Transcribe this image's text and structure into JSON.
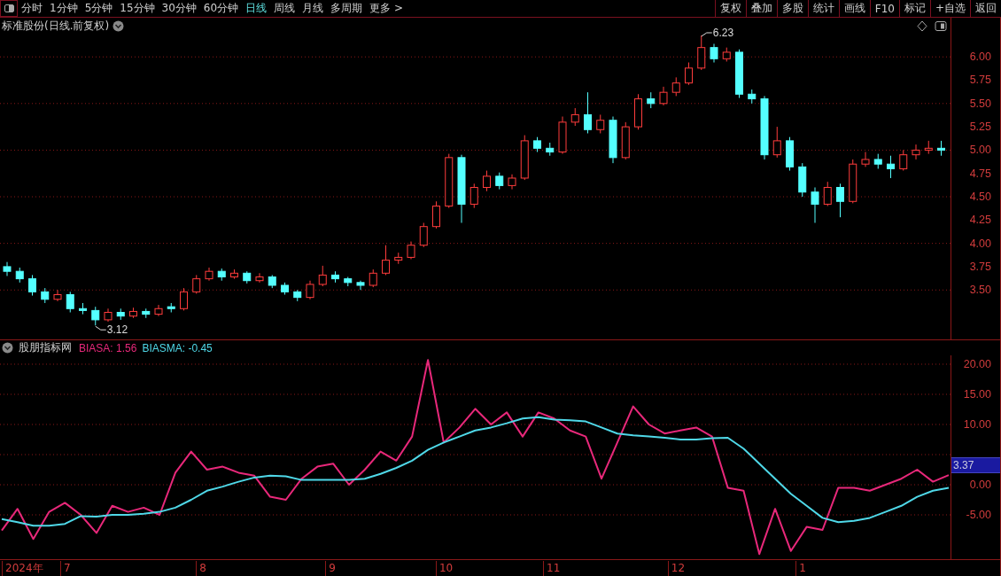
{
  "toolbar": {
    "periods": [
      {
        "label": "分时",
        "selected": false
      },
      {
        "label": "1分钟",
        "selected": false
      },
      {
        "label": "5分钟",
        "selected": false
      },
      {
        "label": "15分钟",
        "selected": false
      },
      {
        "label": "30分钟",
        "selected": false
      },
      {
        "label": "60分钟",
        "selected": false
      },
      {
        "label": "日线",
        "selected": true
      },
      {
        "label": "周线",
        "selected": false
      },
      {
        "label": "月线",
        "selected": false
      },
      {
        "label": "多周期",
        "selected": false
      },
      {
        "label": "更多 >",
        "selected": false
      }
    ],
    "buttons": [
      "复权",
      "叠加",
      "多股",
      "统计",
      "画线",
      "F10",
      "标记",
      "+自选",
      "返回"
    ]
  },
  "price_panel": {
    "title": "标准股份(日线.前复权)",
    "high_label": "6.23",
    "low_label": "3.12",
    "chart_data": {
      "type": "candlestick",
      "grid": true,
      "ylim": [
        2.97,
        6.42
      ],
      "yticks": [
        {
          "value": 6,
          "label": "6.00"
        },
        {
          "value": 5.75,
          "label": "5.75"
        },
        {
          "value": 5.5,
          "label": "5.50"
        },
        {
          "value": 5.25,
          "label": "5.25"
        },
        {
          "value": 5,
          "label": "5.00"
        },
        {
          "value": 4.75,
          "label": "4.75"
        },
        {
          "value": 4.5,
          "label": "4.50"
        },
        {
          "value": 4.25,
          "label": "4.25"
        },
        {
          "value": 4,
          "label": "4.00"
        },
        {
          "value": 3.75,
          "label": "3.75"
        },
        {
          "value": 3.5,
          "label": "3.50"
        }
      ],
      "ohlc": [
        [
          3.75,
          3.8,
          3.65,
          3.7
        ],
        [
          3.7,
          3.74,
          3.58,
          3.62
        ],
        [
          3.62,
          3.66,
          3.44,
          3.48
        ],
        [
          3.48,
          3.52,
          3.36,
          3.4
        ],
        [
          3.4,
          3.5,
          3.38,
          3.45
        ],
        [
          3.45,
          3.48,
          3.26,
          3.3
        ],
        [
          3.3,
          3.36,
          3.24,
          3.28
        ],
        [
          3.28,
          3.32,
          3.12,
          3.18
        ],
        [
          3.18,
          3.3,
          3.16,
          3.26
        ],
        [
          3.26,
          3.3,
          3.18,
          3.22
        ],
        [
          3.22,
          3.31,
          3.2,
          3.27
        ],
        [
          3.27,
          3.3,
          3.2,
          3.24
        ],
        [
          3.24,
          3.34,
          3.22,
          3.3
        ],
        [
          3.32,
          3.36,
          3.26,
          3.3
        ],
        [
          3.3,
          3.52,
          3.28,
          3.48
        ],
        [
          3.48,
          3.66,
          3.46,
          3.62
        ],
        [
          3.62,
          3.74,
          3.6,
          3.7
        ],
        [
          3.7,
          3.73,
          3.6,
          3.64
        ],
        [
          3.64,
          3.72,
          3.62,
          3.68
        ],
        [
          3.68,
          3.7,
          3.57,
          3.6
        ],
        [
          3.6,
          3.68,
          3.58,
          3.64
        ],
        [
          3.64,
          3.66,
          3.52,
          3.55
        ],
        [
          3.55,
          3.58,
          3.45,
          3.48
        ],
        [
          3.48,
          3.5,
          3.38,
          3.42
        ],
        [
          3.42,
          3.6,
          3.4,
          3.56
        ],
        [
          3.56,
          3.76,
          3.54,
          3.66
        ],
        [
          3.66,
          3.7,
          3.58,
          3.62
        ],
        [
          3.62,
          3.64,
          3.54,
          3.58
        ],
        [
          3.58,
          3.6,
          3.5,
          3.55
        ],
        [
          3.55,
          3.72,
          3.53,
          3.68
        ],
        [
          3.68,
          3.98,
          3.66,
          3.82
        ],
        [
          3.82,
          3.9,
          3.78,
          3.85
        ],
        [
          3.85,
          4.02,
          3.83,
          3.98
        ],
        [
          3.98,
          4.22,
          3.96,
          4.18
        ],
        [
          4.18,
          4.45,
          4.16,
          4.4
        ],
        [
          4.4,
          4.96,
          4.38,
          4.92
        ],
        [
          4.92,
          4.95,
          4.22,
          4.42
        ],
        [
          4.42,
          4.64,
          4.38,
          4.6
        ],
        [
          4.6,
          4.78,
          4.56,
          4.72
        ],
        [
          4.72,
          4.76,
          4.58,
          4.62
        ],
        [
          4.62,
          4.74,
          4.58,
          4.7
        ],
        [
          4.7,
          5.16,
          4.68,
          5.1
        ],
        [
          5.1,
          5.14,
          4.98,
          5.02
        ],
        [
          5.02,
          5.08,
          4.94,
          4.98
        ],
        [
          4.98,
          5.36,
          4.96,
          5.3
        ],
        [
          5.3,
          5.45,
          5.26,
          5.38
        ],
        [
          5.38,
          5.62,
          5.18,
          5.22
        ],
        [
          5.22,
          5.38,
          5.18,
          5.32
        ],
        [
          5.32,
          5.36,
          4.86,
          4.92
        ],
        [
          4.92,
          5.3,
          4.9,
          5.25
        ],
        [
          5.25,
          5.6,
          5.22,
          5.55
        ],
        [
          5.55,
          5.62,
          5.45,
          5.5
        ],
        [
          5.5,
          5.68,
          5.48,
          5.62
        ],
        [
          5.62,
          5.78,
          5.58,
          5.72
        ],
        [
          5.72,
          5.94,
          5.7,
          5.88
        ],
        [
          5.88,
          6.23,
          5.86,
          6.1
        ],
        [
          6.1,
          6.14,
          5.94,
          5.98
        ],
        [
          5.98,
          6.1,
          5.95,
          6.05
        ],
        [
          6.05,
          6.08,
          5.56,
          5.6
        ],
        [
          5.6,
          5.65,
          5.5,
          5.55
        ],
        [
          5.55,
          5.58,
          4.9,
          4.95
        ],
        [
          4.95,
          5.25,
          4.92,
          5.1
        ],
        [
          5.1,
          5.14,
          4.78,
          4.82
        ],
        [
          4.82,
          4.86,
          4.5,
          4.55
        ],
        [
          4.55,
          4.6,
          4.22,
          4.42
        ],
        [
          4.42,
          4.66,
          4.4,
          4.6
        ],
        [
          4.6,
          4.64,
          4.28,
          4.45
        ],
        [
          4.45,
          4.9,
          4.43,
          4.85
        ],
        [
          4.85,
          4.98,
          4.82,
          4.9
        ],
        [
          4.9,
          4.96,
          4.8,
          4.85
        ],
        [
          4.85,
          4.94,
          4.7,
          4.8
        ],
        [
          4.8,
          5.0,
          4.78,
          4.95
        ],
        [
          4.95,
          5.06,
          4.9,
          5.0
        ],
        [
          5.0,
          5.1,
          4.96,
          5.02
        ],
        [
          5.02,
          5.1,
          4.94,
          5.0
        ]
      ]
    }
  },
  "indicator": {
    "name": "股朋指标网",
    "readings": [
      ": 1.56",
      ": -0.45"
    ],
    "cursor_value": "3.37",
    "chart_data": {
      "type": "line",
      "grid": true,
      "ylim": [
        -12.35,
        21.47
      ],
      "yticks": [
        {
          "value": 20,
          "label": "20.00"
        },
        {
          "value": 15,
          "label": "15.00"
        },
        {
          "value": 10,
          "label": "10.00"
        },
        {
          "value": 0,
          "label": "0.00"
        },
        {
          "value": -5,
          "label": "-5.00"
        }
      ],
      "series": [
        {
          "name": "BIASA",
          "color": "#e8287a",
          "values": [
            -7.6,
            -4,
            -9,
            -4.5,
            -3,
            -5,
            -8,
            -3.5,
            -4.5,
            -3.8,
            -5,
            2,
            5.5,
            2.5,
            3,
            2,
            1.5,
            -2,
            -2.5,
            1,
            3,
            3.5,
            0,
            2.5,
            5.5,
            4,
            8,
            20.7,
            7,
            9.5,
            12.6,
            10,
            12,
            8,
            12,
            11,
            9,
            8,
            1,
            7,
            13,
            10,
            8.5,
            9,
            9.5,
            8,
            -0.5,
            -1,
            -11.5,
            -4,
            -11,
            -7,
            -7.5,
            -0.5,
            -0.5,
            -1,
            0,
            1,
            2.5,
            0.5,
            1.6
          ]
        },
        {
          "name": "BIASMA",
          "color": "#4fd8e8",
          "values": [
            -5.7,
            -6.2,
            -6.8,
            -6.8,
            -6.5,
            -5.2,
            -5.3,
            -5,
            -5,
            -4.8,
            -4.5,
            -3.8,
            -2.5,
            -1,
            -0.3,
            0.5,
            1.2,
            1.5,
            1.4,
            0.8,
            0.8,
            0.8,
            0.8,
            1,
            1.8,
            2.8,
            4,
            5.8,
            7,
            8,
            9,
            9.5,
            10.2,
            11,
            11.2,
            10.8,
            10.7,
            10.5,
            9.5,
            8.5,
            8.2,
            8,
            7.8,
            7.5,
            7.5,
            7.7,
            7.8,
            6,
            3.5,
            1,
            -1.5,
            -3.5,
            -5.5,
            -6.2,
            -6,
            -5.5,
            -4.5,
            -3.5,
            -2,
            -1,
            -0.5
          ]
        }
      ]
    }
  },
  "date_axis": [
    "2024年",
    "7",
    "8",
    "9",
    "10",
    "11",
    "12",
    "1"
  ]
}
